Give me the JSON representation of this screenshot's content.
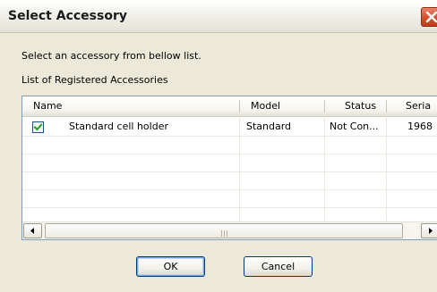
{
  "window": {
    "title": "Select Accessory"
  },
  "prompt": "Select an accessory from bellow list.",
  "list_label": "List of Registered Accessories",
  "table": {
    "columns": [
      "Name",
      "Model",
      "Status",
      "Seria"
    ],
    "rows": [
      {
        "checked": true,
        "name": "Standard cell holder",
        "model": "Standard",
        "status": "Not Con...",
        "serial": "1968"
      }
    ]
  },
  "scrollbar": {
    "grip": "III"
  },
  "buttons": {
    "ok": "OK",
    "cancel": "Cancel"
  },
  "colors": {
    "close_button": "#d2502e",
    "list_border": "#7f9db9",
    "button_border": "#003c74",
    "checkmark": "#21a121"
  },
  "icons": {
    "close": "close-icon",
    "check": "checkmark-icon",
    "scroll_left": "arrow-left-icon",
    "scroll_right": "arrow-right-icon"
  }
}
